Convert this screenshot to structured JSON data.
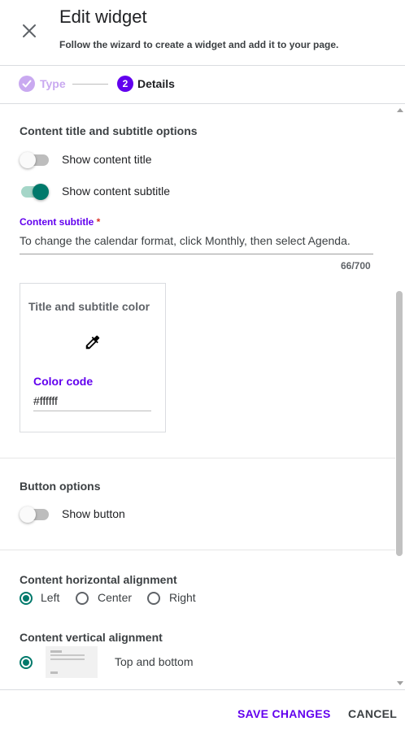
{
  "header": {
    "title": "Edit widget",
    "subtitle": "Follow the wizard to create a widget and add it to your page."
  },
  "stepper": {
    "steps": [
      {
        "label": "Type",
        "state": "completed"
      },
      {
        "label": "Details",
        "number": "2",
        "state": "active"
      }
    ]
  },
  "content_options": {
    "section_title": "Content title and subtitle options",
    "show_title": {
      "label": "Show content title",
      "on": false
    },
    "show_subtitle": {
      "label": "Show content subtitle",
      "on": true
    },
    "subtitle_field": {
      "label": "Content subtitle",
      "required_mark": "*",
      "value": "To change the calendar format, click Monthly, then select Agenda.",
      "counter": "66/700"
    },
    "color_card": {
      "title": "Title and subtitle color",
      "icon": "eyedropper-icon",
      "code_label": "Color code",
      "code_value": "#ffffff"
    }
  },
  "button_options": {
    "section_title": "Button options",
    "show_button": {
      "label": "Show button",
      "on": false
    }
  },
  "alignment": {
    "horizontal_title": "Content horizontal alignment",
    "horizontal_options": [
      {
        "label": "Left",
        "checked": true
      },
      {
        "label": "Center",
        "checked": false
      },
      {
        "label": "Right",
        "checked": false
      }
    ],
    "vertical_title": "Content vertical alignment",
    "vertical_options": [
      {
        "label": "Top and bottom",
        "checked": true
      }
    ]
  },
  "footer": {
    "save_label": "SAVE CHANGES",
    "cancel_label": "CANCEL"
  },
  "colors": {
    "primary": "#6200ee",
    "teal": "#00796b",
    "teal_light": "#a5d6c8",
    "completed_step": "#c9a9f0"
  }
}
